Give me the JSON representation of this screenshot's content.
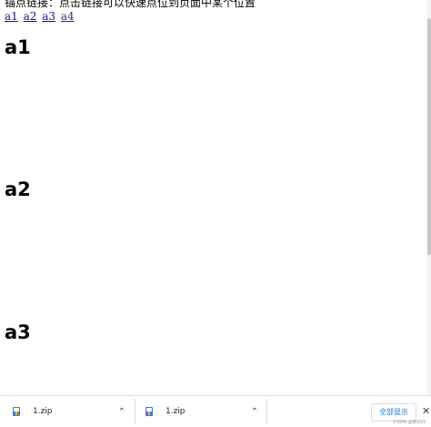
{
  "page": {
    "intro": "锚点链接：点击链接可以快速点位到页面中某个位置",
    "links": [
      "a1",
      "a2",
      "a3",
      "a4"
    ],
    "headings": [
      "a1",
      "a2",
      "a3"
    ]
  },
  "download_bar": {
    "items": [
      {
        "filename": "1.zip",
        "icon": "zip-file-icon"
      },
      {
        "filename": "1.zip",
        "icon": "zip-file-icon"
      }
    ],
    "chevron": "⌃",
    "show_all_label": "全部显示",
    "close_label": "✕",
    "watermark": "CSDN @IBE03"
  },
  "colors": {
    "link": "#1a0dab",
    "visited": "#551a8b",
    "accent": "#1a73e8"
  }
}
